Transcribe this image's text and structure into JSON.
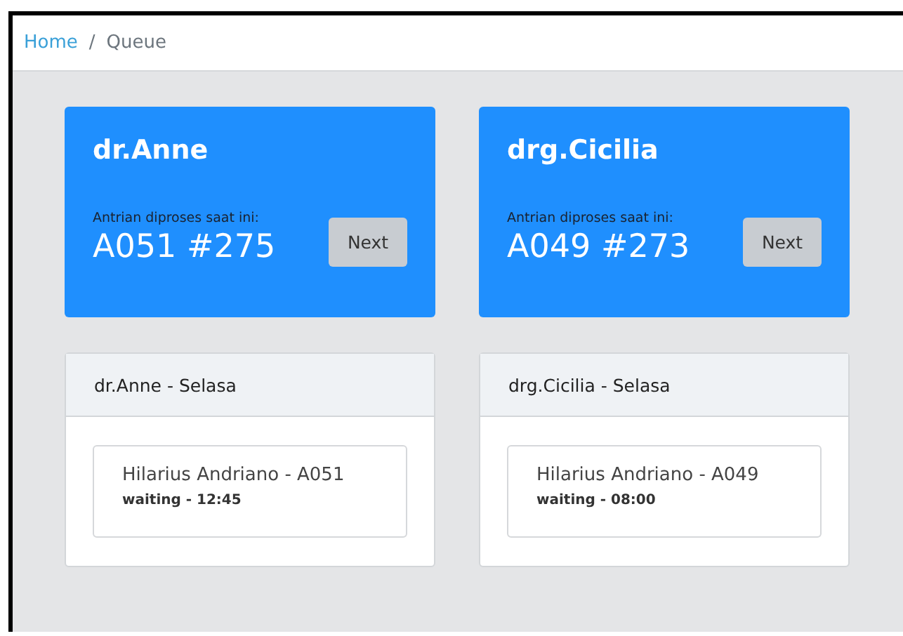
{
  "breadcrumb": [
    {
      "label": "Home",
      "selected": false
    },
    {
      "label": "Queue",
      "selected": true
    }
  ],
  "separator": "/",
  "doctors": [
    {
      "name": "dr.Anne",
      "caption": "Antrian diproses saat ini:",
      "current": "A051 #275",
      "button": "Next",
      "schedule_title": "dr.Anne - Selasa",
      "queue": [
        {
          "patient": "Hilarius Andriano - A051",
          "status": "waiting - 12:45"
        }
      ]
    },
    {
      "name": "drg.Cicilia",
      "caption": "Antrian diproses saat ini:",
      "current": "A049 #273",
      "button": "Next",
      "schedule_title": "drg.Cicilia - Selasa",
      "queue": [
        {
          "patient": "Hilarius Andriano - A049",
          "status": "waiting - 08:00"
        }
      ]
    }
  ]
}
